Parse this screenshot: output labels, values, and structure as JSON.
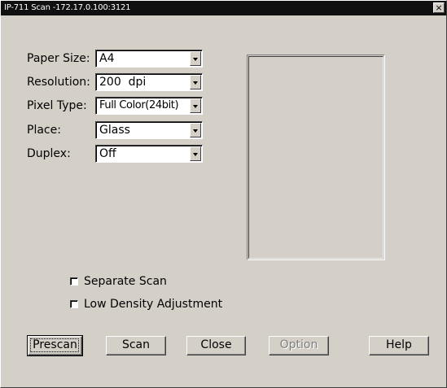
{
  "window": {
    "title": "IP-711 Scan -172.17.0.100:3121",
    "close_glyph": "×"
  },
  "form": {
    "paper_size": {
      "label": "Paper Size:",
      "value": "A4"
    },
    "resolution": {
      "label": "Resolution:",
      "value": "200  dpi"
    },
    "pixel_type": {
      "label": "Pixel Type:",
      "value": "Full Color(24bit)"
    },
    "place": {
      "label": "Place:",
      "value": "Glass"
    },
    "duplex": {
      "label": "Duplex:",
      "value": "Off"
    }
  },
  "options": {
    "separate_scan": {
      "label": "Separate Scan",
      "checked": false
    },
    "low_density": {
      "label": "Low Density Adjustment",
      "checked": false
    }
  },
  "buttons": {
    "prescan": "Prescan",
    "scan": "Scan",
    "close": "Close",
    "option": "Option",
    "help": "Help"
  }
}
